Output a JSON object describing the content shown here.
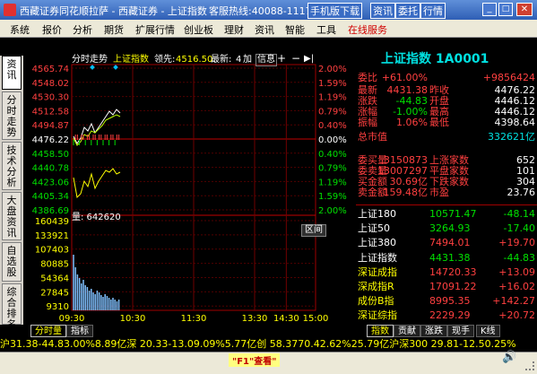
{
  "title": "西藏证券同花顺拉萨 - 西藏证券 - 上证指数",
  "hotline": "客服热线:40088-11177",
  "title_buttons": [
    "手机版下载",
    "资讯",
    "委托",
    "行情"
  ],
  "menu": [
    "系统",
    "报价",
    "分析",
    "期货",
    "扩展行情",
    "创业板",
    "理财",
    "资讯",
    "智能",
    "工具",
    "在线服务"
  ],
  "vtabs": [
    "资讯",
    "分时走势",
    "技术分析",
    "大盘资讯",
    "自选股",
    "综合排名"
  ],
  "chart_header": {
    "label": "分时走势",
    "name": "上证指数",
    "lead_label": "领先:",
    "lead": "4516.50",
    "latest_label": "最新:",
    "latest": "4",
    "add": "加",
    "info": "信息",
    "plus": "+",
    "minus": "−"
  },
  "price_ticks": [
    "4565.74",
    "4548.02",
    "4530.30",
    "4512.58",
    "4494.87",
    "4476.22",
    "4458.50",
    "4440.78",
    "4423.06",
    "4405.34",
    "4386.69"
  ],
  "pct_ticks": [
    "2.00%",
    "1.59%",
    "1.19%",
    "0.79%",
    "0.40%",
    "0.00%",
    "0.40%",
    "0.79%",
    "1.19%",
    "1.59%",
    "2.00%"
  ],
  "volume_label": "量: 642620",
  "volume_button": "区间",
  "vol_ticks": [
    "160439",
    "133921",
    "107403",
    "80885",
    "54364",
    "27845",
    "9310"
  ],
  "time_ticks": [
    "09:30",
    "10:30",
    "11:30",
    "13:30",
    "14:30",
    "15:00"
  ],
  "bottom_tabs": [
    "分时量",
    "指标"
  ],
  "quote": {
    "title": "上证指数 1A0001",
    "rows": [
      {
        "l": "委比",
        "v": "+61.00%",
        "r": "",
        "rv": "+9856424"
      },
      {
        "l": "最新",
        "v": "4431.38",
        "r": "昨收",
        "rv": "4476.22"
      },
      {
        "l": "涨跌",
        "v": "-44.83",
        "r": "开盘",
        "rv": "4446.12"
      },
      {
        "l": "涨幅",
        "v": "-1.00%",
        "r": "最高",
        "rv": "4446.12"
      },
      {
        "l": "振幅",
        "v": "1.06%",
        "r": "最低",
        "rv": "4398.64"
      },
      {
        "l": "总市值",
        "v": "",
        "r": "",
        "rv": "332621亿"
      },
      {
        "l": "委买量",
        "v": "3150873",
        "r": "上涨家数",
        "rv": "652"
      },
      {
        "l": "委卖量",
        "v": "13007297",
        "r": "平盘家数",
        "rv": "101"
      },
      {
        "l": "买金额",
        "v": "30.69亿",
        "r": "下跌家数",
        "rv": "304"
      },
      {
        "l": "卖金额",
        "v": "159.48亿",
        "r": "市盈",
        "rv": "23.76"
      }
    ],
    "indices": [
      {
        "n": "上证180",
        "p": "10571.47",
        "c": "-48.14"
      },
      {
        "n": "上证50",
        "p": "3264.93",
        "c": "-17.40"
      },
      {
        "n": "上证380",
        "p": "7494.01",
        "c": "+19.70"
      },
      {
        "n": "上证指数",
        "p": "4431.38",
        "c": "-44.83"
      },
      {
        "n": "深证成指",
        "p": "14720.33",
        "c": "+13.09"
      },
      {
        "n": "深成指R",
        "p": "17091.22",
        "c": "+16.02"
      },
      {
        "n": "成份B指",
        "p": "8995.35",
        "c": "+142.27"
      },
      {
        "n": "深证综指",
        "p": "2229.29",
        "c": "+20.72"
      }
    ]
  },
  "right_tabs": [
    "指数",
    "贡献",
    "涨跌",
    "现手",
    "K线"
  ],
  "ticker": "沪31.38-44.83.00%8.89亿深 20.33-13.09.09%5.77亿创 58.3770.42.62%25.79亿沪深300 29.81-12.50.25%",
  "status_hint": "\"F1\"查看\""
}
